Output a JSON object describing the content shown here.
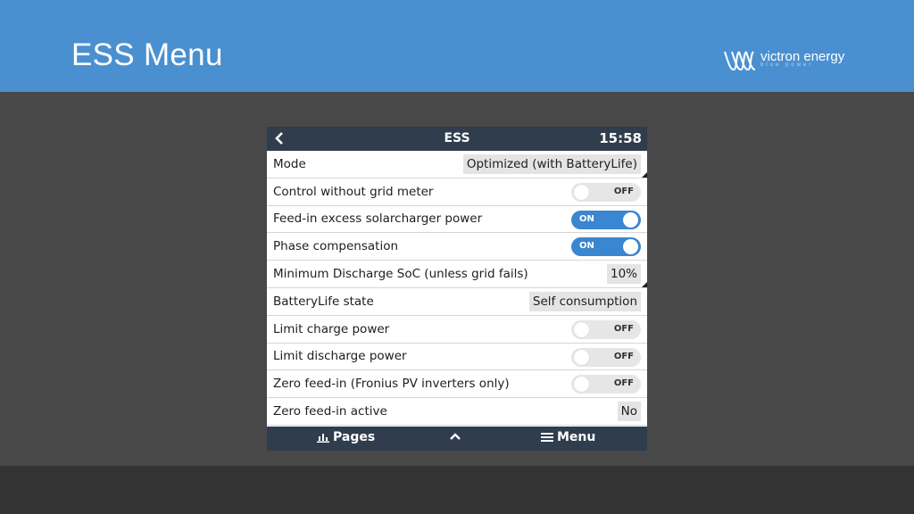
{
  "slide": {
    "title": "ESS Menu",
    "brand_name": "victron energy",
    "brand_tagline": "blue power"
  },
  "colors": {
    "header_blue": "#4a90d1",
    "background": "#484848",
    "device_bar": "#2f3d4d",
    "toggle_on": "#3a86d0",
    "toggle_off": "#e6e6e6"
  },
  "device": {
    "back_icon": "chevron-left-icon",
    "title": "ESS",
    "time": "15:58",
    "rows": [
      {
        "label": "Mode",
        "value": "Optimized (with BatteryLife)"
      },
      {
        "label": "Control without grid meter",
        "toggle": "OFF"
      },
      {
        "label": "Feed-in excess solarcharger power",
        "toggle": "ON"
      },
      {
        "label": "Phase compensation",
        "toggle": "ON"
      },
      {
        "label": "Minimum Discharge SoC (unless grid fails)",
        "value": "10%"
      },
      {
        "label": "BatteryLife state",
        "value": "Self consumption"
      },
      {
        "label": "Limit charge power",
        "toggle": "OFF"
      },
      {
        "label": "Limit discharge power",
        "toggle": "OFF"
      },
      {
        "label": "Zero feed-in (Fronius PV inverters only)",
        "toggle": "OFF"
      },
      {
        "label": "Zero feed-in active",
        "value": "No"
      }
    ],
    "footer": {
      "pages_label": "Pages",
      "pages_icon": "bar-chart-icon",
      "up_icon": "chevron-up-icon",
      "menu_label": "Menu",
      "menu_icon": "hamburger-icon"
    }
  }
}
